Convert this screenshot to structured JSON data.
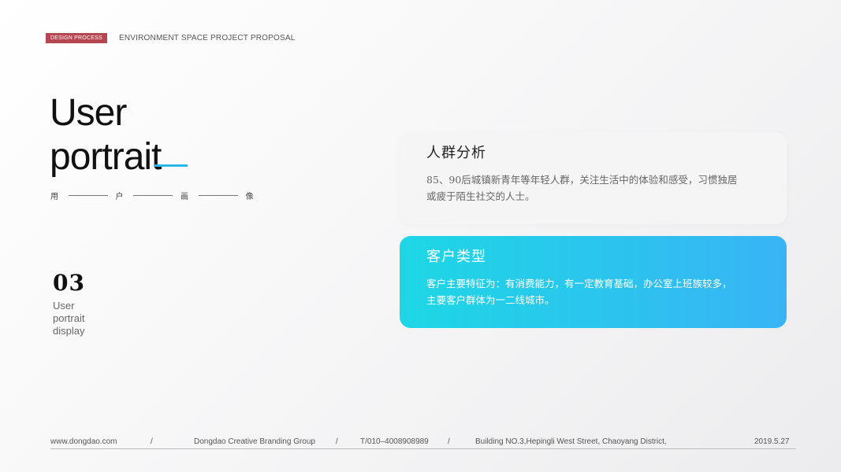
{
  "header": {
    "badge": "DESIGN PROCESS",
    "title": "ENVIRONMENT SPACE PROJECT PROPOSAL"
  },
  "main_title": {
    "line1": "User",
    "line2": "portrait"
  },
  "subtitle_chars": [
    "用",
    "户",
    "画",
    "像"
  ],
  "section": {
    "number": "03",
    "label_line1": "User",
    "label_line2": "portrait",
    "label_line3": "display"
  },
  "cards": [
    {
      "title": "人群分析",
      "text_line1": "85、90后城镇新青年等年轻人群，关注生活中的体验和感受，习惯独居",
      "text_line2": "或疲于陌生社交的人士。"
    },
    {
      "title": "客户类型",
      "text_line1": "客户主要特征为：有消费能力，有一定教育基础，办公室上班族较多，",
      "text_line2": "主要客户群体为一二线城市。"
    }
  ],
  "footer": {
    "website": "www.dongdao.com",
    "sep": "/",
    "company": "Dongdao Creative Branding Group",
    "phone": "T/010–4008908989",
    "address": "Building NO.3,Hepingli West Street, Chaoyang District,",
    "date": "2019.5.27"
  },
  "colors": {
    "badge": "#b5454f",
    "accent_line": "#2bb8e8",
    "card2_gradient_start": "#1dd7e5",
    "card2_gradient_end": "#38b4f5"
  }
}
